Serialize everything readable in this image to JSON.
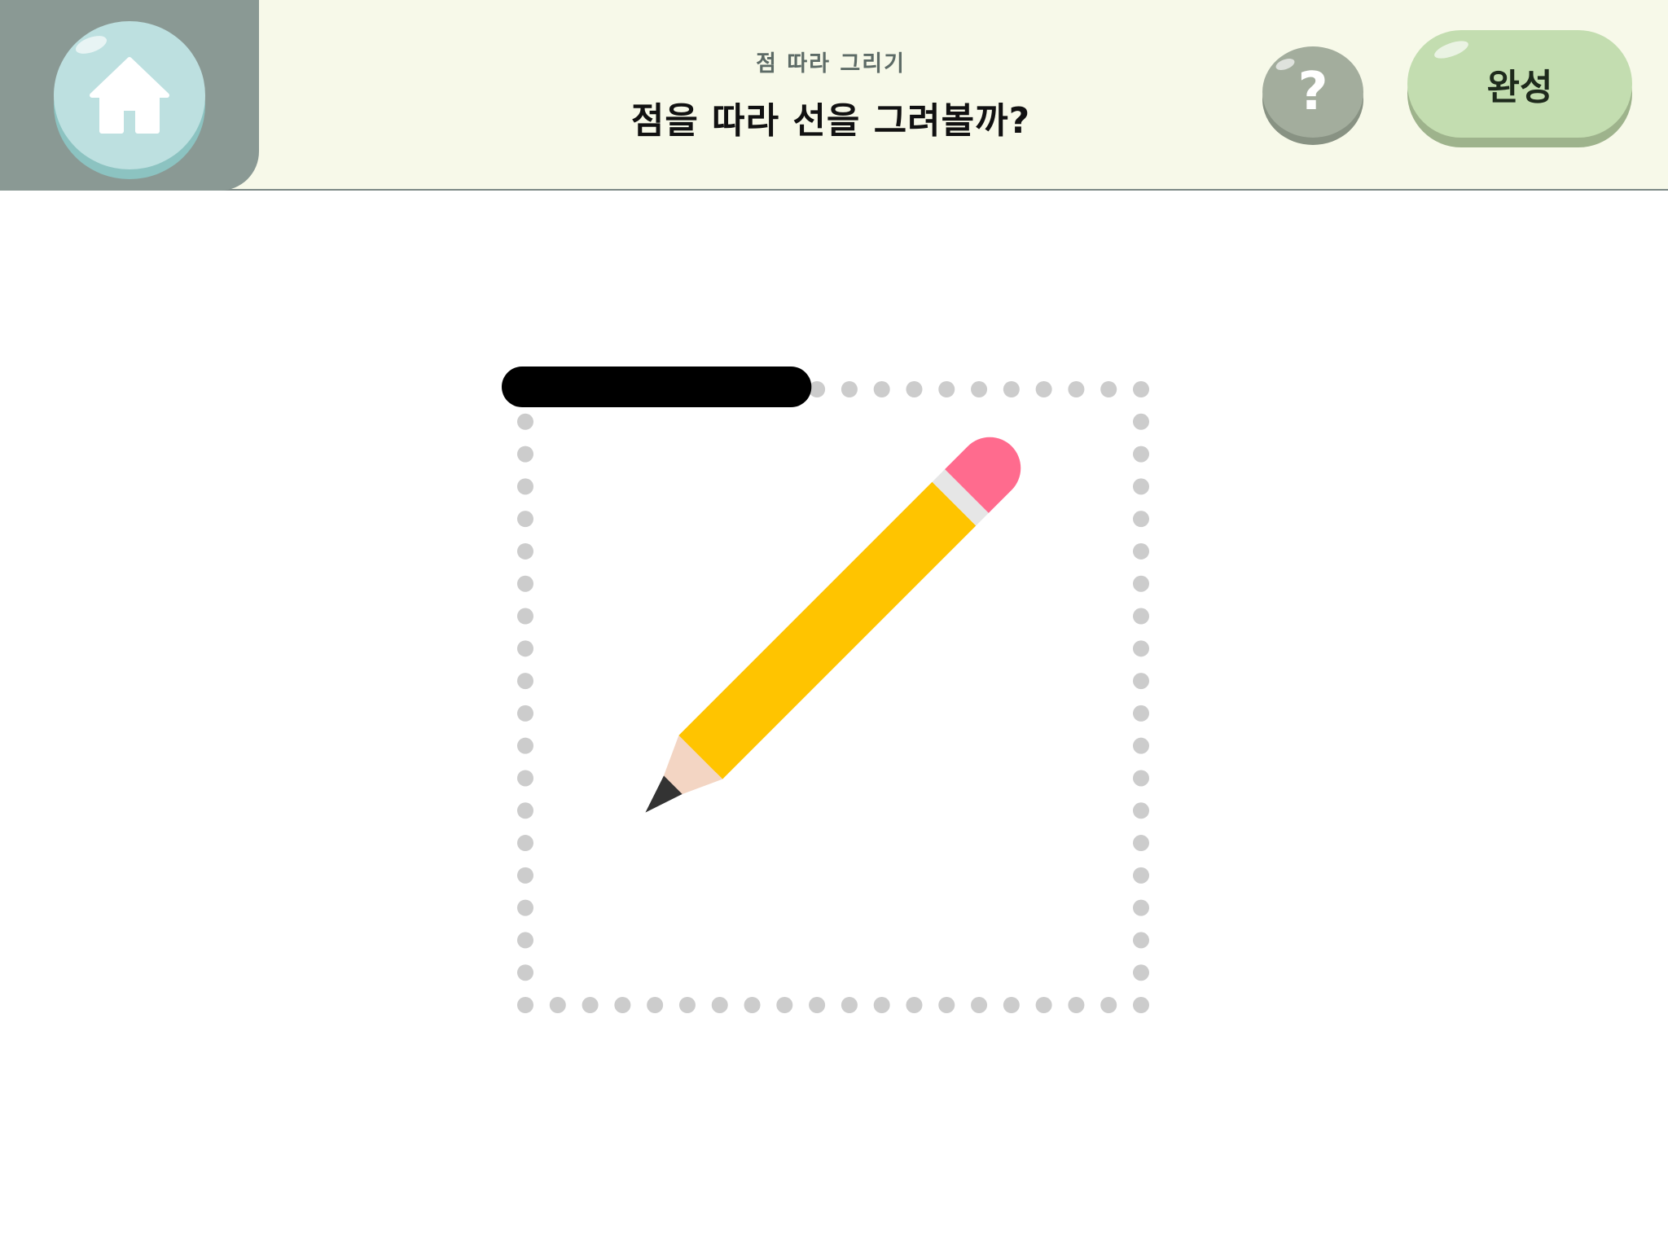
{
  "header": {
    "subtitle": "점 따라 그리기",
    "title": "점을 따라 선을 그려볼까?",
    "help_label": "?",
    "done_label": "완성"
  },
  "icons": {
    "home": "home-icon",
    "help": "question-mark-icon",
    "pencil": "pencil-icon"
  },
  "colors": {
    "header_bg": "#f7f9e9",
    "home_panel": "#8a9994",
    "home_button": "#bde0e0",
    "help_button": "#a3ad9d",
    "done_button": "#c3ddb0",
    "dot": "#cccccc",
    "drawn_line": "#000000",
    "pencil_body": "#ffc400",
    "pencil_eraser": "#ff6b8e"
  },
  "activity": {
    "shape": "square",
    "dots_per_side": 20,
    "segments_drawn": 8
  }
}
